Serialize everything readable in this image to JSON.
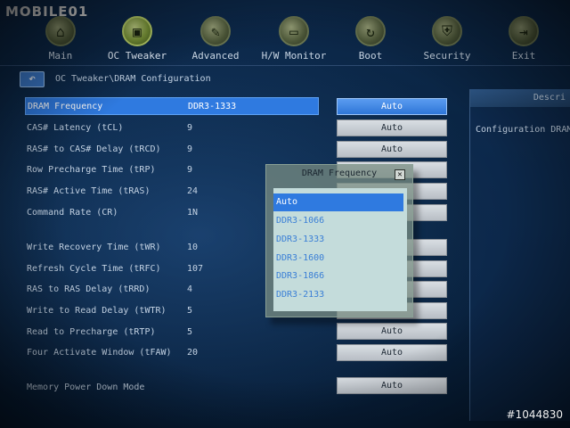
{
  "watermark": "MOBILE01",
  "photo_id": "#1044830",
  "nav": {
    "items": [
      {
        "label": "Main",
        "icon": "home-icon",
        "glyph": "⌂",
        "active": false
      },
      {
        "label": "OC Tweaker",
        "icon": "chip-icon",
        "glyph": "▣",
        "active": true
      },
      {
        "label": "Advanced",
        "icon": "wrench-icon",
        "glyph": "✎",
        "active": false
      },
      {
        "label": "H/W Monitor",
        "icon": "monitor-icon",
        "glyph": "▭",
        "active": false
      },
      {
        "label": "Boot",
        "icon": "refresh-icon",
        "glyph": "↻",
        "active": false
      },
      {
        "label": "Security",
        "icon": "shield-icon",
        "glyph": "⛨",
        "active": false
      },
      {
        "label": "Exit",
        "icon": "exit-runner-icon",
        "glyph": "⇥",
        "active": false
      }
    ]
  },
  "breadcrumb": "OC Tweaker\\DRAM Configuration",
  "back_glyph": "↶",
  "settings": [
    {
      "label": "DRAM Frequency",
      "value": "DDR3-1333",
      "option": "Auto",
      "selected": true
    },
    {
      "label": "CAS# Latency (tCL)",
      "value": "9",
      "option": "Auto"
    },
    {
      "label": "RAS# to CAS# Delay (tRCD)",
      "value": "9",
      "option": "Auto"
    },
    {
      "label": "Row Precharge Time (tRP)",
      "value": "9",
      "option": ""
    },
    {
      "label": "RAS# Active Time (tRAS)",
      "value": "24",
      "option": ""
    },
    {
      "label": "Command Rate (CR)",
      "value": "1N",
      "option": ""
    },
    {
      "label": "Write Recovery Time (tWR)",
      "value": "10",
      "option": ""
    },
    {
      "label": "Refresh Cycle Time (tRFC)",
      "value": "107",
      "option": ""
    },
    {
      "label": "RAS to RAS Delay (tRRD)",
      "value": "4",
      "option": ""
    },
    {
      "label": "Write to Read Delay (tWTR)",
      "value": "5",
      "option": ""
    },
    {
      "label": "Read to Precharge (tRTP)",
      "value": "5",
      "option": "Auto"
    },
    {
      "label": "Four Activate Window (tFAW)",
      "value": "20",
      "option": "Auto"
    },
    {
      "label": "Memory Power Down Mode",
      "value": "",
      "option": "Auto"
    }
  ],
  "description": {
    "title": "Descri",
    "text": "Configuration DRAM"
  },
  "popup": {
    "title": "DRAM Frequency",
    "close_glyph": "✕",
    "options": [
      "Auto",
      "DDR3-1066",
      "DDR3-1333",
      "DDR3-1600",
      "DDR3-1866",
      "DDR3-2133"
    ],
    "selected_index": 0
  }
}
